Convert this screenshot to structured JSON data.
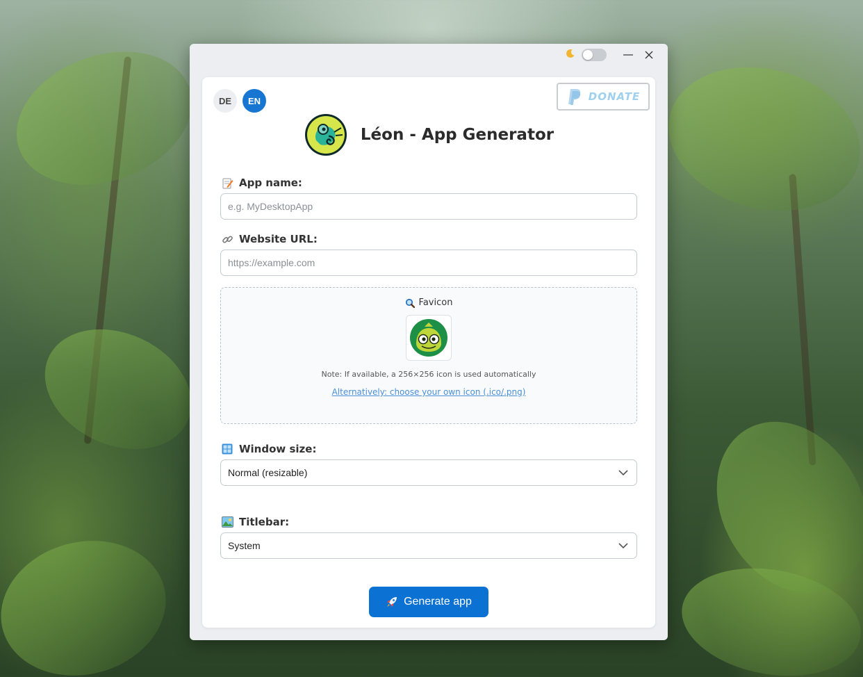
{
  "window": {
    "theme_toggle_icon": "moon-icon",
    "minimize_icon": "minimize-icon",
    "close_icon": "close-icon"
  },
  "languages": [
    {
      "code": "DE",
      "active": false
    },
    {
      "code": "EN",
      "active": true
    }
  ],
  "donate": {
    "label": "DONATE",
    "icon": "paypal-icon"
  },
  "header": {
    "title": "Léon - App Generator",
    "logo": "chameleon-logo"
  },
  "form": {
    "app_name": {
      "label": "App name:",
      "icon": "memo-icon",
      "value": "",
      "placeholder": "e.g. MyDesktopApp"
    },
    "website_url": {
      "label": "Website URL:",
      "icon": "link-icon",
      "value": "",
      "placeholder": "https://example.com"
    },
    "favicon": {
      "label": "Favicon",
      "icon": "magnifier-icon",
      "note": "Note: If available, a 256×256 icon is used automatically",
      "choose_link": "Alternatively: choose your own icon (.ico/.png)"
    },
    "window_size": {
      "label": "Window size:",
      "icon": "windows-icon",
      "selected": "Normal (resizable)"
    },
    "titlebar": {
      "label": "Titlebar:",
      "icon": "picture-icon",
      "selected": "System"
    }
  },
  "actions": {
    "generate_label": "Generate app",
    "generate_icon": "rocket-icon"
  },
  "colors": {
    "accent": "#0b72d4",
    "language_active": "#1676d2",
    "link": "#4a8fd6",
    "donate_text": "#9fd1ef"
  }
}
